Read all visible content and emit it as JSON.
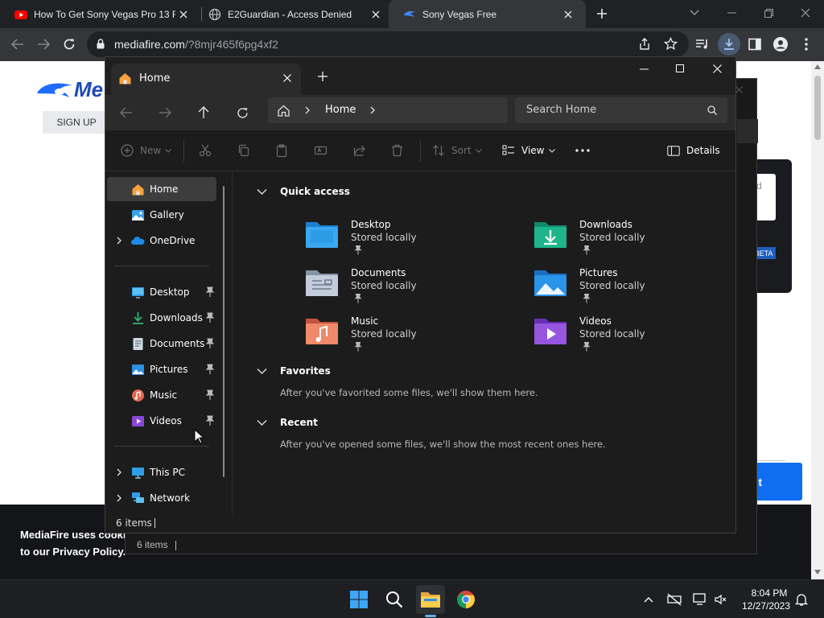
{
  "chrome": {
    "tabs": [
      {
        "title": "How To Get Sony Vegas Pro 13 F",
        "favicon": "youtube-icon"
      },
      {
        "title": "E2Guardian - Access Denied",
        "favicon": "globe-icon"
      },
      {
        "title": "Sony Vegas Free",
        "favicon": "mediafire-icon"
      }
    ],
    "url_domain": "mediafire.com",
    "url_path": "/?8mjr465f6pg4xf2"
  },
  "webpage": {
    "logo_text": "Me",
    "signup_label": "SIGN UP",
    "card_text": "d",
    "beta_badge": "BETA",
    "cookie_text_line1": "MediaFire uses cooki",
    "cookie_text_line2": "to our Privacy Policy.",
    "cookie_button_label": "t"
  },
  "ghost_explorer": {
    "status": "6 items"
  },
  "explorer": {
    "tab_title": "Home",
    "address_location": "Home",
    "search_placeholder": "Search Home",
    "commands": {
      "new_label": "New",
      "sort_label": "Sort",
      "view_label": "View",
      "details_label": "Details"
    },
    "nav": {
      "top": [
        {
          "label": "Home",
          "icon": "home-icon"
        },
        {
          "label": "Gallery",
          "icon": "gallery-icon"
        },
        {
          "label": "OneDrive",
          "icon": "onedrive-icon"
        }
      ],
      "pinned": [
        {
          "label": "Desktop",
          "icon": "desktop-icon"
        },
        {
          "label": "Downloads",
          "icon": "downloads-icon"
        },
        {
          "label": "Documents",
          "icon": "documents-icon"
        },
        {
          "label": "Pictures",
          "icon": "pictures-icon"
        },
        {
          "label": "Music",
          "icon": "music-icon"
        },
        {
          "label": "Videos",
          "icon": "videos-icon"
        }
      ],
      "bottom": [
        {
          "label": "This PC",
          "icon": "this-pc-icon"
        },
        {
          "label": "Network",
          "icon": "network-icon"
        }
      ]
    },
    "sections": {
      "quick_access": "Quick access",
      "favorites": "Favorites",
      "favorites_msg": "After you've favorited some files, we'll show them here.",
      "recent": "Recent",
      "recent_msg": "After you've opened some files, we'll show the most recent ones here."
    },
    "quick_access_items": [
      {
        "name": "Desktop",
        "status": "Stored locally",
        "icon": "desktop-folder-icon"
      },
      {
        "name": "Downloads",
        "status": "Stored locally",
        "icon": "downloads-folder-icon"
      },
      {
        "name": "Documents",
        "status": "Stored locally",
        "icon": "documents-folder-icon"
      },
      {
        "name": "Pictures",
        "status": "Stored locally",
        "icon": "pictures-folder-icon"
      },
      {
        "name": "Music",
        "status": "Stored locally",
        "icon": "music-folder-icon"
      },
      {
        "name": "Videos",
        "status": "Stored locally",
        "icon": "videos-folder-icon"
      }
    ],
    "status": "6 items"
  },
  "taskbar": {
    "time": "8:04 PM",
    "date": "12/27/2023"
  },
  "colors": {
    "chrome_bg": "#202124",
    "explorer_bg": "#1c1c1c",
    "accent": "#0f6ef2"
  }
}
